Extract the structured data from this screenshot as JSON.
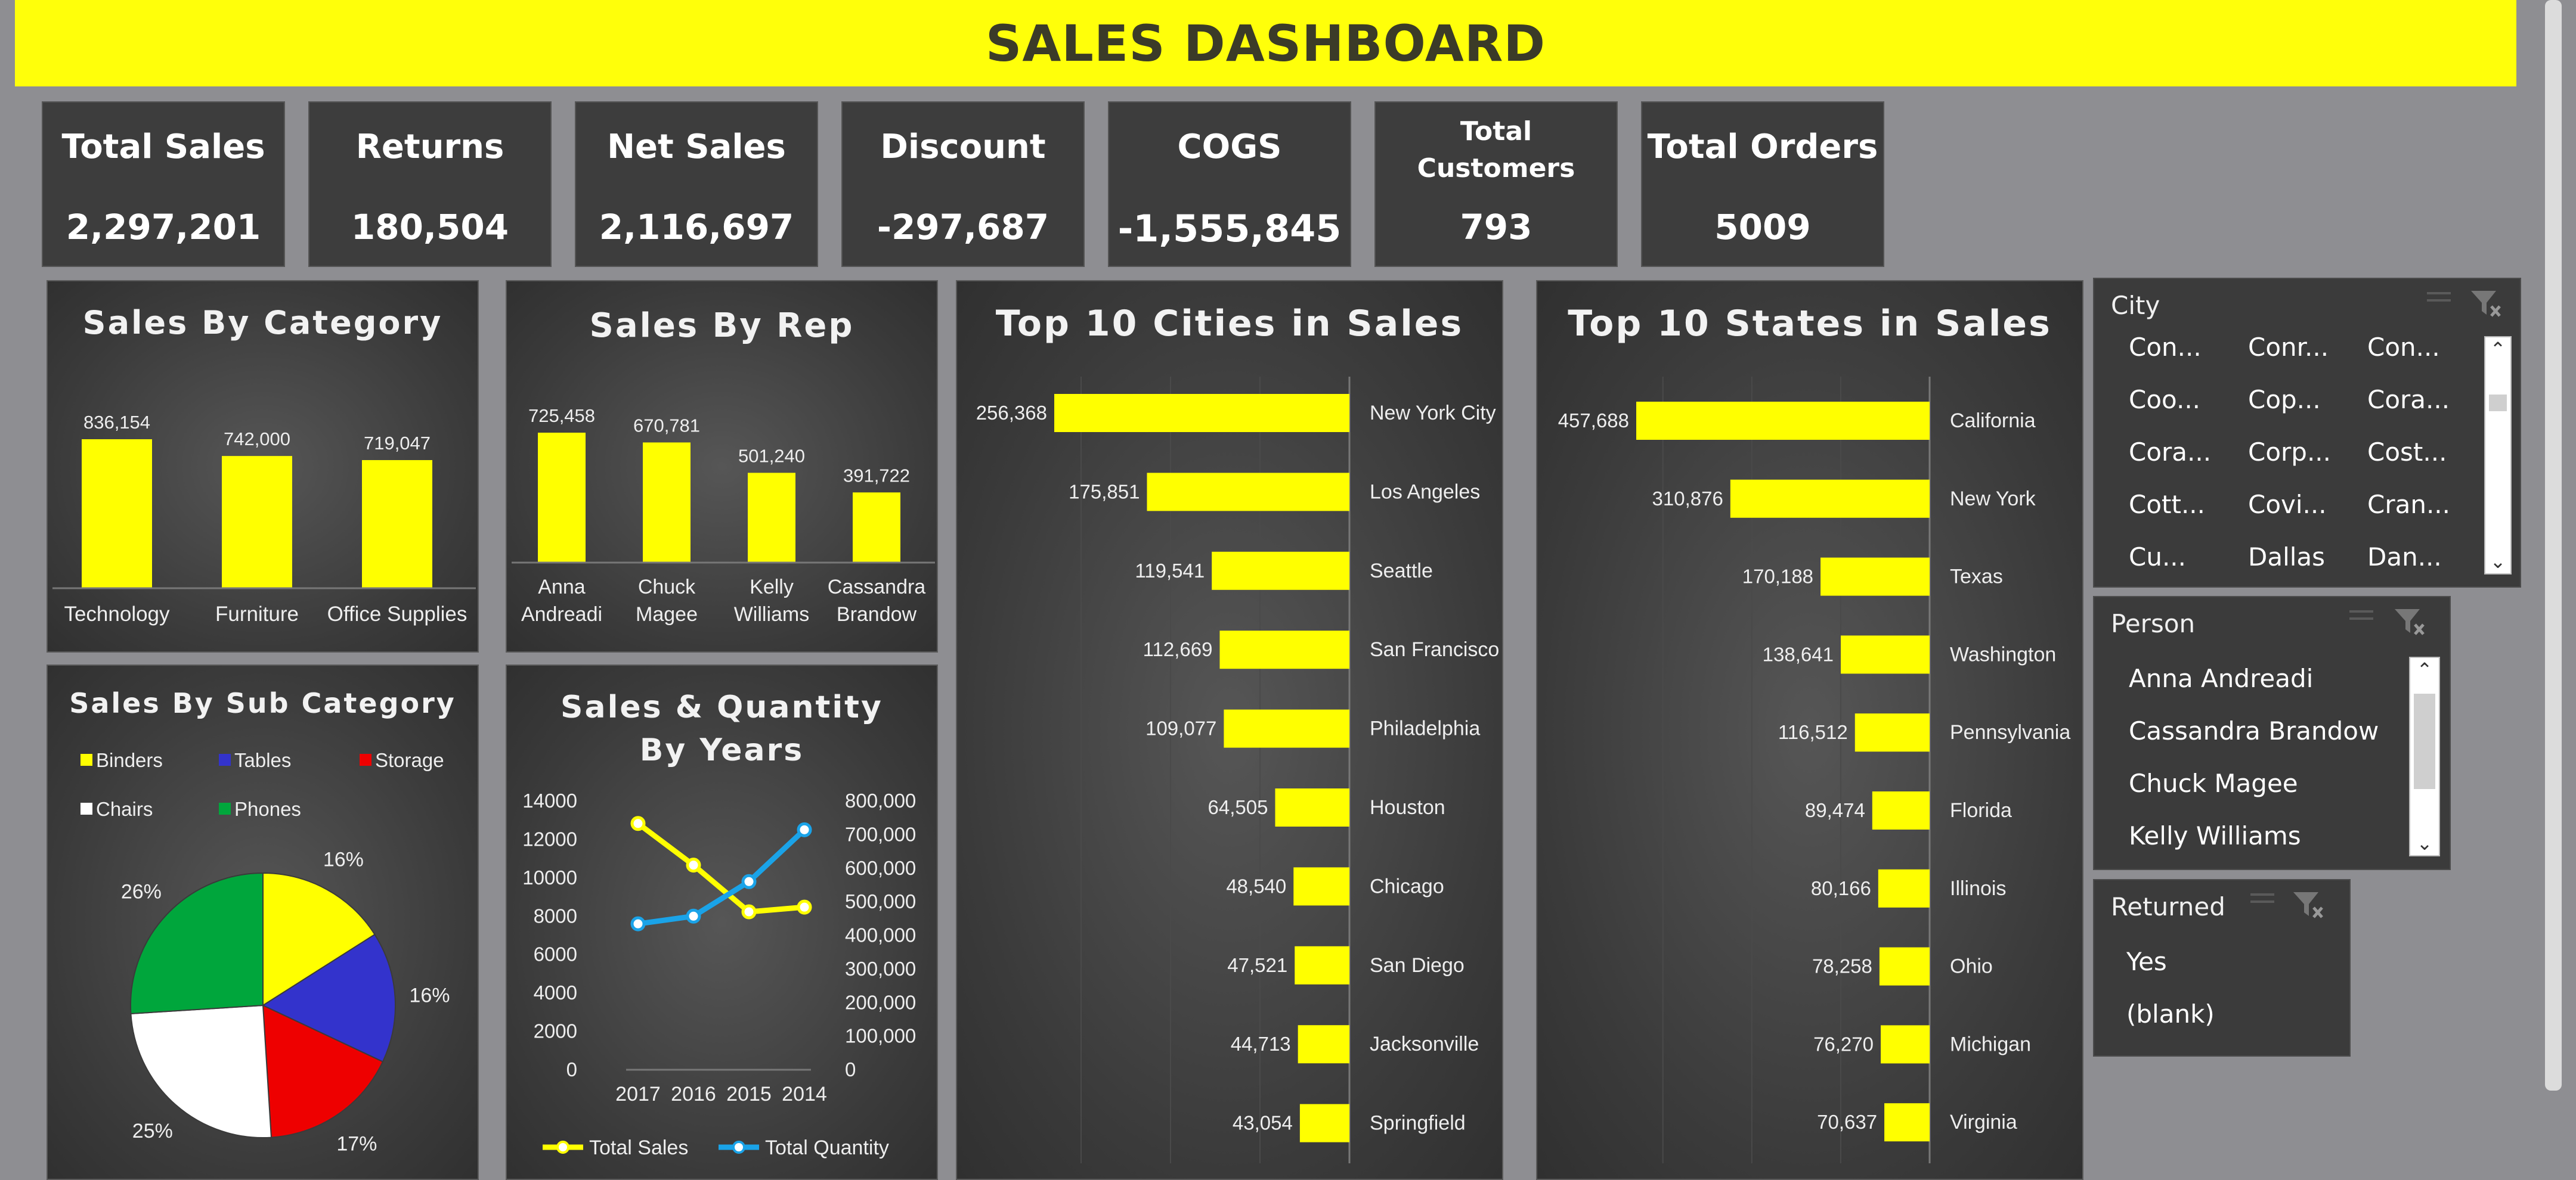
{
  "header": {
    "title": "SALES DASHBOARD"
  },
  "kpis": [
    {
      "label": "Total Sales",
      "value": "2,297,201"
    },
    {
      "label": "Returns",
      "value": "180,504"
    },
    {
      "label": "Net Sales",
      "value": "2,116,697"
    },
    {
      "label": "Discount",
      "value": "-297,687"
    },
    {
      "label": "COGS",
      "value": "-1,555,845"
    },
    {
      "label_line1": "Total",
      "label_line2": "Customers",
      "value": "793"
    },
    {
      "label": "Total Orders",
      "value": "5009"
    }
  ],
  "colors": {
    "accent": "#ffff00",
    "header_bg": "#ffff0a",
    "panel_bg": "#3a3a3a",
    "page_bg": "#8e8e92"
  },
  "chart_data": [
    {
      "type": "bar",
      "title": "Sales By Category",
      "categories": [
        "Technology",
        "Furniture",
        "Office Supplies"
      ],
      "values": [
        836154,
        742000,
        719047
      ],
      "value_labels": [
        "836,154",
        "742,000",
        "719,047"
      ],
      "color": "#ffff00"
    },
    {
      "type": "bar",
      "title": "Sales By Rep",
      "categories": [
        [
          "Anna",
          "Andreadi"
        ],
        [
          "Chuck",
          "Magee"
        ],
        [
          "Kelly",
          "Williams"
        ],
        [
          "Cassandra",
          "Brandow"
        ]
      ],
      "values": [
        725458,
        670781,
        501240,
        391722
      ],
      "value_labels": [
        "725,458",
        "670,781",
        "501,240",
        "391,722"
      ],
      "color": "#ffff00"
    },
    {
      "type": "pie",
      "title": "Sales By Sub Category",
      "legend": [
        "Binders",
        "Tables",
        "Storage",
        "Chairs",
        "Phones"
      ],
      "slices": [
        {
          "name": "Binders",
          "value": 16,
          "label": "16%",
          "color": "#ffff00"
        },
        {
          "name": "Tables",
          "value": 16,
          "label": "16%",
          "color": "#3333cc"
        },
        {
          "name": "Storage",
          "value": 17,
          "label": "17%",
          "color": "#ee0000"
        },
        {
          "name": "Chairs",
          "value": 25,
          "label": "25%",
          "color": "#ffffff"
        },
        {
          "name": "Phones",
          "value": 26,
          "label": "26%",
          "color": "#00a63c"
        }
      ]
    },
    {
      "type": "line",
      "title_line1": "Sales & Quantity",
      "title_line2": "By Years",
      "categories": [
        "2017",
        "2016",
        "2015",
        "2014"
      ],
      "y_left_ticks": [
        "14000",
        "12000",
        "10000",
        "8000",
        "6000",
        "4000",
        "2000",
        "0"
      ],
      "y_right_ticks": [
        "800,000",
        "700,000",
        "600,000",
        "500,000",
        "400,000",
        "300,000",
        "200,000",
        "100,000",
        "0"
      ],
      "ylim_left": [
        0,
        14000
      ],
      "ylim_right": [
        0,
        800000
      ],
      "series": [
        {
          "name": "Total Sales",
          "axis": "right",
          "color": "#ffff00",
          "values": [
            733000,
            609000,
            470000,
            484000
          ]
        },
        {
          "name": "Total Quantity",
          "axis": "left",
          "color": "#1aa3e8",
          "values": [
            7600,
            8000,
            9800,
            12500
          ]
        }
      ]
    },
    {
      "type": "bar",
      "orientation": "horizontal",
      "title": "Top 10 Cities in Sales",
      "categories": [
        "New York City",
        "Los Angeles",
        "Seattle",
        "San Francisco",
        "Philadelphia",
        "Houston",
        "Chicago",
        "San Diego",
        "Jacksonville",
        "Springfield"
      ],
      "values": [
        256368,
        175851,
        119541,
        112669,
        109077,
        64505,
        48540,
        47521,
        44713,
        43054
      ],
      "value_labels": [
        "256,368",
        "175,851",
        "119,541",
        "112,669",
        "109,077",
        "64,505",
        "48,540",
        "47,521",
        "44,713",
        "43,054"
      ],
      "color": "#ffff00"
    },
    {
      "type": "bar",
      "orientation": "horizontal",
      "title": "Top 10 States in Sales",
      "categories": [
        "California",
        "New York",
        "Texas",
        "Washington",
        "Pennsylvania",
        "Florida",
        "Illinois",
        "Ohio",
        "Michigan",
        "Virginia"
      ],
      "values": [
        457688,
        310876,
        170188,
        138641,
        116512,
        89474,
        80166,
        78258,
        76270,
        70637
      ],
      "value_labels": [
        "457,688",
        "310,876",
        "170,188",
        "138,641",
        "116,512",
        "89,474",
        "80,166",
        "78,258",
        "76,270",
        "70,637"
      ],
      "color": "#ffff00"
    }
  ],
  "slicers": {
    "city": {
      "header": "City",
      "items": [
        "Con...",
        "Conr...",
        "Con...",
        "Coo...",
        "Cop...",
        "Cora...",
        "Cora...",
        "Corp...",
        "Cost...",
        "Cott...",
        "Covi...",
        "Cran...",
        "Cu...",
        "Dallas",
        "Dan..."
      ]
    },
    "person": {
      "header": "Person",
      "items": [
        "Anna Andreadi",
        "Cassandra Brandow",
        "Chuck Magee",
        "Kelly Williams"
      ]
    },
    "returned": {
      "header": "Returned",
      "items": [
        "Yes",
        "(blank)"
      ]
    }
  }
}
